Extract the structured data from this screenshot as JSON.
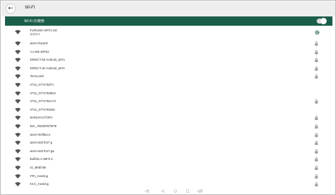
{
  "app": {
    "title": "Wi-Fi"
  },
  "toggle": {
    "label": "Wi-Fi の使用",
    "on": true
  },
  "networks": [
    {
      "name": "FURUNO-VIRT1-5G",
      "status": "接続済み",
      "secured": false,
      "settings": true,
      "icon": "wifi-icon"
    },
    {
      "name": "aterm-fa1a02",
      "secured": true,
      "icon": "wifi-icon"
    },
    {
      "name": "A-LINK-WPS2",
      "secured": true,
      "icon": "wifi-icon"
    },
    {
      "name": "DIRECT-kd-Android_a07a",
      "secured": true,
      "icon": "wifi-icon"
    },
    {
      "name": "DIRECT-uh-Android_a07e",
      "secured": true,
      "icon": "wifi-icon"
    },
    {
      "name": "Tomo.pool",
      "secured": true,
      "icon": "wifi-icon"
    },
    {
      "name": "HT11_6774762F1",
      "secured": false,
      "icon": "wifi-icon"
    },
    {
      "name": "HT11_6774762B04",
      "secured": false,
      "icon": "wifi-icon"
    },
    {
      "name": "HT11_6774762A73",
      "secured": true,
      "icon": "wifi-icon"
    },
    {
      "name": "HT11_6774762MG",
      "secured": false,
      "icon": "wifi-icon"
    },
    {
      "name": "MANUFACTORY",
      "secured": true,
      "icon": "wifi-icon"
    },
    {
      "name": "IMA_7B2987B7B7B",
      "secured": true,
      "icon": "wifi-icon"
    },
    {
      "name": "aterm-9cf9ba-a",
      "secured": true,
      "icon": "wifi-icon"
    },
    {
      "name": "aterm-B1FD47-g",
      "secured": true,
      "icon": "wifi-icon"
    },
    {
      "name": "aterm-B1FD47-gw",
      "secured": true,
      "icon": "wifi-icon"
    },
    {
      "name": "Buffalo-A-56F0-C",
      "secured": true,
      "icon": "wifi-icon"
    },
    {
      "name": "IO_M6B759",
      "secured": true,
      "icon": "wifi-icon"
    },
    {
      "name": "FPA_meeting",
      "secured": true,
      "icon": "wifi-icon"
    },
    {
      "name": "KCC_meeting",
      "secured": true,
      "icon": "wifi-icon"
    }
  ],
  "navbar": {
    "buttons": [
      {
        "name": "volume-down-button",
        "glyph": "◁)"
      },
      {
        "name": "back-button",
        "glyph": "◁"
      },
      {
        "name": "home-button",
        "glyph": "○"
      },
      {
        "name": "recents-button",
        "glyph": "□"
      },
      {
        "name": "volume-up-button",
        "glyph": "◁))"
      }
    ]
  },
  "colors": {
    "accent": "#1b5e4c",
    "icon": "#555555",
    "lock": "#9e9e9e"
  }
}
